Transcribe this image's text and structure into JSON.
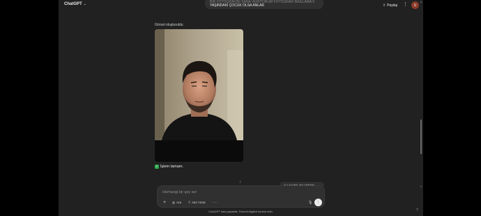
{
  "header": {
    "model_label": "ChatGPT",
    "model_chevron_icon": "chevron-down-icon",
    "share_label": "Paylaş",
    "share_icon": "share-up-icon",
    "more_icon": "kebab-icon",
    "avatar_initial": "U"
  },
  "conversation": {
    "user_message_line1": "BIR FOTOĞRAFINI SANA VERIYORUM FOTOĞRAFI BAĞLAMA 5",
    "user_message_line2": "YAŞINDAKİ ÇOCUK OLSA ANLAR",
    "generated_image_label": "Görsel oluşturuldu",
    "status_text": "İşlem tamam.",
    "status_icon": "checkmark-icon",
    "background_pill_text": "ALLAH BELANI VERSİN"
  },
  "composer": {
    "placeholder": "Herhangi bir şey sor",
    "plus_icon": "plus-icon",
    "search_label": "Ara",
    "search_icon": "globe-icon",
    "think_label": "Akıl Yürüt",
    "think_icon": "lightbulb-icon",
    "more_label": "···",
    "mic_icon": "mic-icon",
    "voice_icon": "voice-mode-icon"
  },
  "footer": {
    "disclaimer": "ChatGPT hata yapabilir. Önemli bilgileri kontrol edin.",
    "help_label": "?"
  },
  "colors": {
    "app_background": "#212121",
    "bubble_background": "#303030",
    "success_green": "#2ca84c"
  }
}
